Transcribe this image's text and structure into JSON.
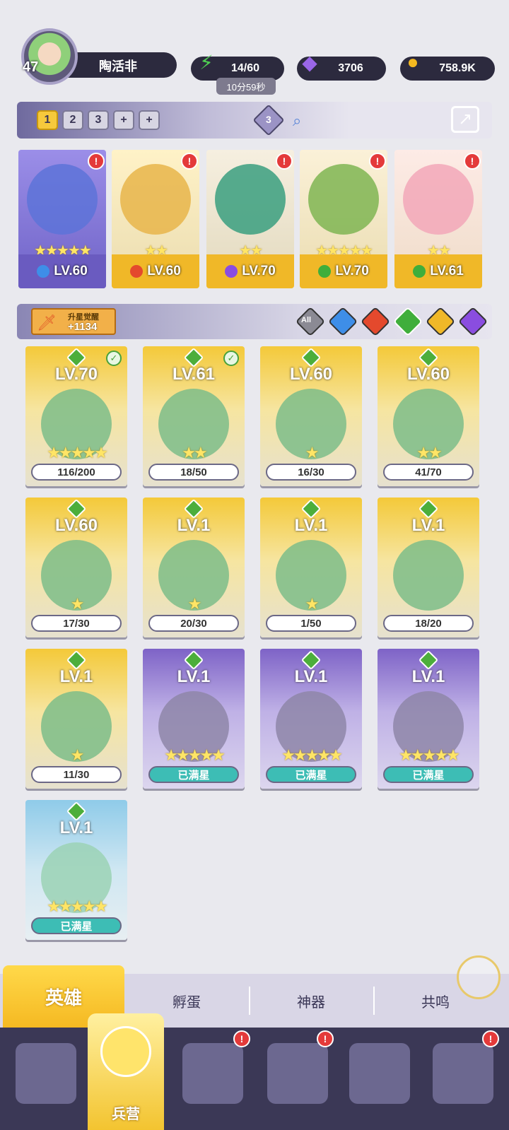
{
  "profile": {
    "level": "47",
    "name": "陶活非"
  },
  "resources": {
    "energy": "14/60",
    "energy_timer": "10分59秒",
    "gems": "3706",
    "gold": "758.9K"
  },
  "team": {
    "slots": [
      "1",
      "2",
      "3",
      "+",
      "+"
    ],
    "active_slot": "1",
    "badge_count": "3",
    "heroes": [
      {
        "level": "LV.60",
        "element": "water",
        "stars": "★★★★★",
        "alert": "!"
      },
      {
        "level": "LV.60",
        "element": "fire",
        "stars": "★★",
        "alert": "!"
      },
      {
        "level": "LV.70",
        "element": "dark",
        "stars": "★★",
        "alert": "!"
      },
      {
        "level": "LV.70",
        "element": "wind",
        "stars": "★★★★★",
        "alert": "!"
      },
      {
        "level": "LV.61",
        "element": "wind",
        "stars": "★★",
        "alert": "!"
      }
    ]
  },
  "filter": {
    "awaken_label": "升星觉醒",
    "awaken_value": "+1134",
    "all_label": "All"
  },
  "heroes": [
    {
      "level": "LV.70",
      "progress": "116/200",
      "stars": "★★★★★",
      "checked": true,
      "frame": "gold"
    },
    {
      "level": "LV.61",
      "progress": "18/50",
      "stars": "★★",
      "checked": true,
      "frame": "gold"
    },
    {
      "level": "LV.60",
      "progress": "16/30",
      "stars": "★",
      "checked": false,
      "frame": "gold"
    },
    {
      "level": "LV.60",
      "progress": "41/70",
      "stars": "★★",
      "checked": false,
      "frame": "gold"
    },
    {
      "level": "LV.60",
      "progress": "17/30",
      "stars": "★",
      "checked": false,
      "frame": "gold"
    },
    {
      "level": "LV.1",
      "progress": "20/30",
      "stars": "★",
      "checked": false,
      "frame": "gold"
    },
    {
      "level": "LV.1",
      "progress": "1/50",
      "stars": "★",
      "checked": false,
      "frame": "gold"
    },
    {
      "level": "LV.1",
      "progress": "18/20",
      "stars": "",
      "checked": false,
      "frame": "gold"
    },
    {
      "level": "LV.1",
      "progress": "11/30",
      "stars": "★",
      "checked": false,
      "frame": "gold"
    },
    {
      "level": "LV.1",
      "progress": "已满星",
      "stars": "★★★★★",
      "checked": false,
      "frame": "purple"
    },
    {
      "level": "LV.1",
      "progress": "已满星",
      "stars": "★★★★★",
      "checked": false,
      "frame": "purple"
    },
    {
      "level": "LV.1",
      "progress": "已满星",
      "stars": "★★★★★",
      "checked": false,
      "frame": "purple"
    },
    {
      "level": "LV.1",
      "progress": "已满星",
      "stars": "★★★★★",
      "checked": false,
      "frame": "blue"
    }
  ],
  "tabs": [
    "英雄",
    "孵蛋",
    "神器",
    "共鸣"
  ],
  "nav": {
    "active_label": "兵营",
    "alert": "!"
  },
  "colors": {
    "gold_frame": "#f4c939",
    "purple_frame": "#7e63c7",
    "alert": "#e43a3a",
    "nav_bg": "#3b3856"
  }
}
